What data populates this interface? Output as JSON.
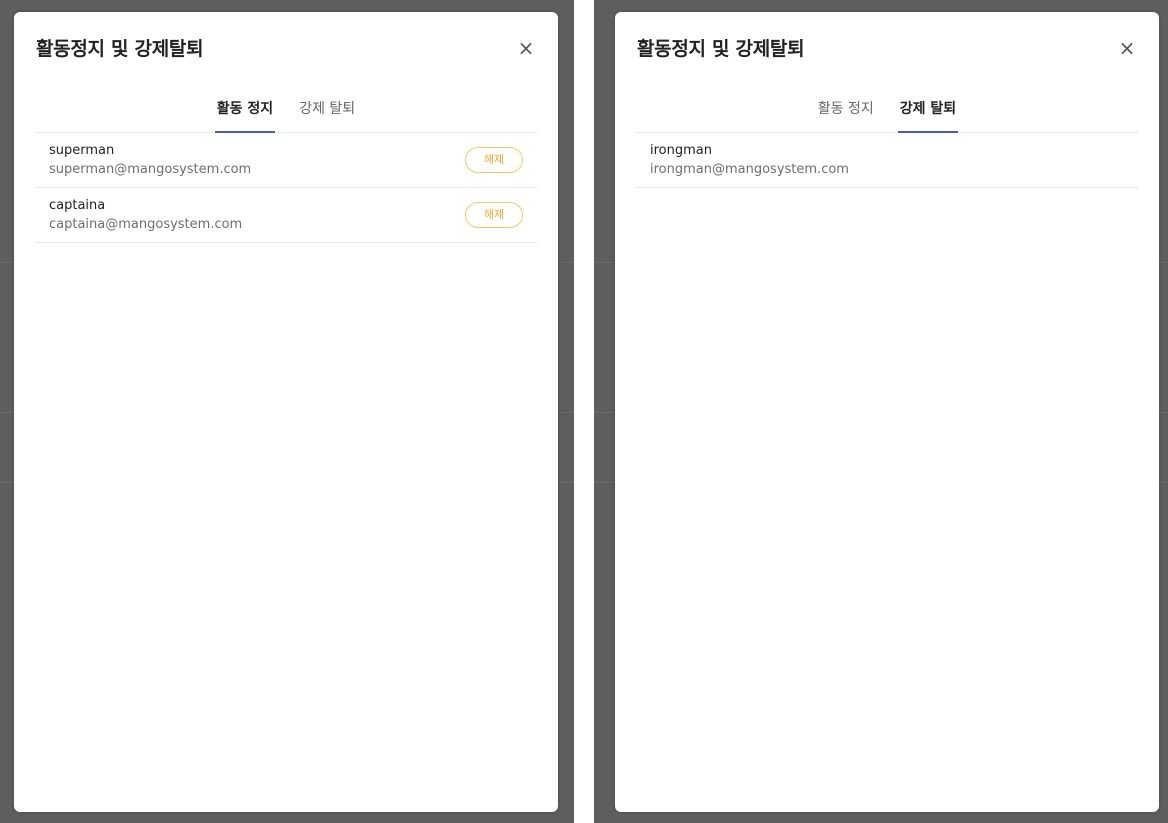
{
  "left_modal": {
    "title": "활동정지 및 강제탈퇴",
    "close_label": "×",
    "tabs": [
      {
        "label": "활동 정지",
        "active": true
      },
      {
        "label": "강제 탈퇴",
        "active": false
      }
    ],
    "rows": [
      {
        "name": "superman",
        "email": "superman@mangosystem.com",
        "action_label": "해제"
      },
      {
        "name": "captaina",
        "email": "captaina@mangosystem.com",
        "action_label": "해제"
      }
    ]
  },
  "right_modal": {
    "title": "활동정지 및 강제탈퇴",
    "close_label": "×",
    "tabs": [
      {
        "label": "활동 정지",
        "active": false
      },
      {
        "label": "강제 탈퇴",
        "active": true
      }
    ],
    "rows": [
      {
        "name": "irongman",
        "email": "irongman@mangosystem.com"
      }
    ]
  },
  "colors": {
    "accent_tab_underline": "#4a5fa8",
    "release_button_border": "#f5c96a",
    "release_button_text": "#f0a830",
    "backdrop": "#5e5e5e"
  },
  "icons": {
    "close": "close-icon"
  }
}
